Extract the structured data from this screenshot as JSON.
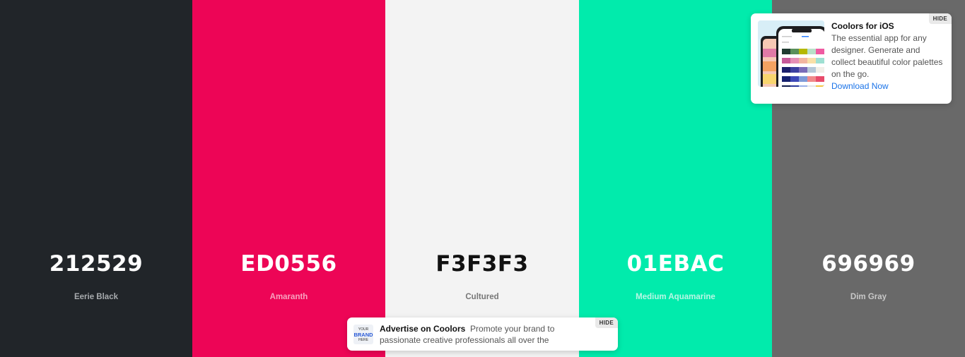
{
  "palette": {
    "swatches": [
      {
        "hex": "212529",
        "name": "Eerie Black",
        "bg": "#212529",
        "text_color": "#ffffff",
        "name_color": "#a8abae"
      },
      {
        "hex": "ED0556",
        "name": "Amaranth",
        "bg": "#ED0556",
        "text_color": "#ffffff",
        "name_color": "#f7a3bf"
      },
      {
        "hex": "F3F3F3",
        "name": "Cultured",
        "bg": "#F3F3F3",
        "text_color": "#111111",
        "name_color": "#777777"
      },
      {
        "hex": "01EBAC",
        "name": "Medium Aquamarine",
        "bg": "#01EBAC",
        "text_color": "#ffffff",
        "name_color": "#b8f7e4"
      },
      {
        "hex": "696969",
        "name": "Dim Gray",
        "bg": "#696969",
        "text_color": "#ffffff",
        "name_color": "#c8c8c8"
      }
    ]
  },
  "ios_ad": {
    "hide_label": "HIDE",
    "title": "Coolors for iOS",
    "description": "The essential app for any designer. Generate and collect beautiful color palettes on the go.",
    "link_label": "Download Now"
  },
  "brand_ad": {
    "hide_label": "HIDE",
    "logo_line1": "YOUR",
    "logo_line2": "BRAND",
    "logo_line3": "HERE",
    "title": "Advertise on Coolors",
    "description": "Promote your brand to passionate creative professionals all over the"
  }
}
